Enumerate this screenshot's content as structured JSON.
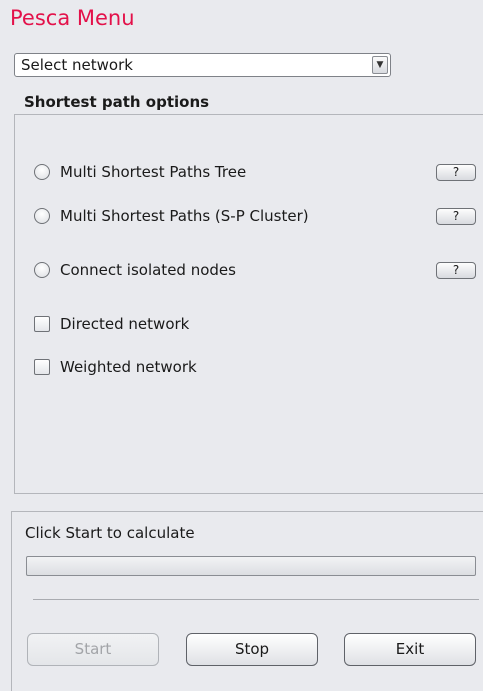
{
  "app": {
    "title": "Pesca Menu",
    "accent_color": "#e3114a"
  },
  "network_select": {
    "value": "Select network",
    "arrow_icon": "triangle-down-icon"
  },
  "options": {
    "section_title": "Shortest path options",
    "radios": [
      {
        "label": "Multi Shortest Paths Tree",
        "help": "?"
      },
      {
        "label": "Multi Shortest Paths (S-P Cluster)",
        "help": "?"
      },
      {
        "label": "Connect isolated nodes",
        "help": "?"
      }
    ],
    "checkboxes": [
      {
        "label": "Directed network",
        "checked": false
      },
      {
        "label": "Weighted network",
        "checked": false
      }
    ]
  },
  "status": {
    "text": "Click Start to calculate",
    "progress": 0
  },
  "buttons": {
    "start": "Start",
    "stop": "Stop",
    "exit": "Exit"
  }
}
